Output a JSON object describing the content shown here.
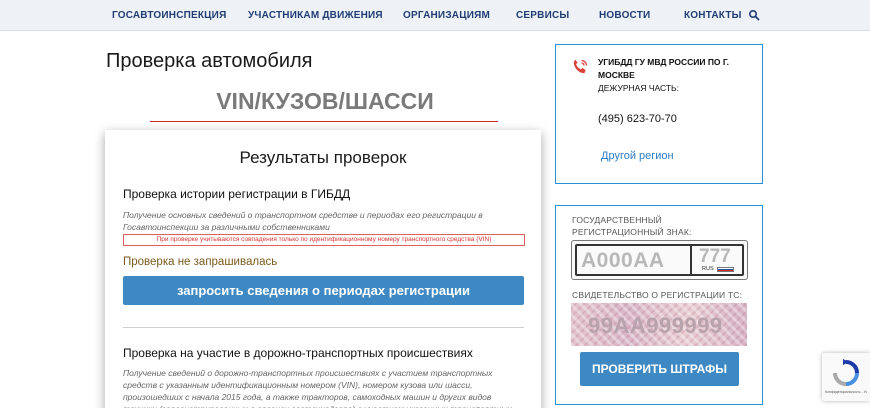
{
  "nav": {
    "items": [
      {
        "label": "ГОСАВТОИНСПЕКЦИЯ"
      },
      {
        "label": "УЧАСТНИКАМ ДВИЖЕНИЯ"
      },
      {
        "label": "ОРГАНИЗАЦИЯМ"
      },
      {
        "label": "СЕРВИСЫ"
      },
      {
        "label": "НОВОСТИ"
      },
      {
        "label": "КОНТАКТЫ"
      }
    ],
    "search_icon": "search-icon"
  },
  "page": {
    "title": "Проверка автомобиля",
    "vin_heading": "VIN/КУЗОВ/ШАССИ"
  },
  "results": {
    "title": "Результаты проверок",
    "registration": {
      "title": "Проверка истории регистрации в ГИБДД",
      "description": "Получение основных сведений о транспортном средстве и периодах его регистрации в Госавтоинспекции за различными собственниками",
      "warning": "При проверке учитываются совпадения только по идентификационному номеру транспортного средства (VIN)",
      "status": "Проверка не запрашивалась",
      "button_label": "запросить сведения о периодах регистрации"
    },
    "accidents": {
      "title": "Проверка на участие в дорожно-транспортных происшествиях",
      "description": "Получение сведений о дорожно-транспортных происшествиях с участием транспортных средств с указанным идентификационным номером (VIN), номером кузова или шасси, произошедших с начала 2015 года, а также тракторов, самоходных машин и других видов техники (зарегистрированных в органах гостехнадзора) с участием указанных транспортных средств"
    }
  },
  "contact": {
    "icon": "phone-icon",
    "org_name": "УГИБДД ГУ МВД РОССИИ ПО Г. МОСКВЕ",
    "duty_label": "ДЕЖУРНАЯ ЧАСТЬ:",
    "phone": "(495) 623-70-70",
    "other_region": "Другой регион"
  },
  "fines": {
    "plate_label": "ГОСУДАРСТВЕННЫЙ РЕГИСТРАЦИОННЫЙ ЗНАК:",
    "plate_number": "А000АА",
    "plate_region": "777",
    "plate_country": "RUS",
    "cert_label": "СВИДЕТЕЛЬСТВО О РЕГИСТРАЦИИ ТС:",
    "cert_number": "99АА999999",
    "button_label": "ПРОВЕРИТЬ ШТРАФЫ"
  },
  "recaptcha": {
    "icon": "recaptcha-icon",
    "links": "Конфиденциальность - Условия использования"
  },
  "colors": {
    "accent": "#3e89c3",
    "nav_text": "#1f3d73",
    "border": "#2a8fd4",
    "warning": "#d33333",
    "underline": "#c9302c"
  }
}
